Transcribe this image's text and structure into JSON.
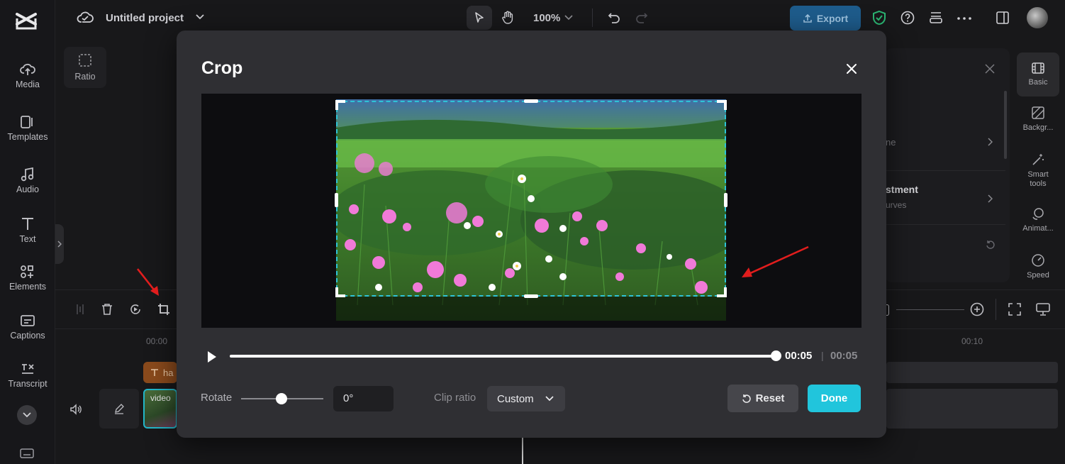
{
  "sidebar": {
    "items": [
      {
        "label": "Media"
      },
      {
        "label": "Templates"
      },
      {
        "label": "Audio"
      },
      {
        "label": "Text"
      },
      {
        "label": "Elements"
      },
      {
        "label": "Captions"
      },
      {
        "label": "Transcript"
      }
    ]
  },
  "topbar": {
    "project_title": "Untitled project",
    "zoom": "100%",
    "export_label": "Export"
  },
  "workspace": {
    "ratio_label": "Ratio"
  },
  "right_panel": {
    "row1_fragment": "ne",
    "row2_title_fragment": "stment",
    "row2_sub_fragment": "urves"
  },
  "right_tabs": [
    {
      "label": "Basic"
    },
    {
      "label": "Backgr..."
    },
    {
      "label": "Smart tools"
    },
    {
      "label": "Animat..."
    },
    {
      "label": "Speed"
    }
  ],
  "timeline": {
    "ruler_start": "00:00",
    "ruler_end": "00:10",
    "text_clip_label": "ha",
    "video_clip_label": "video"
  },
  "crop_dialog": {
    "title": "Crop",
    "time_current": "00:05",
    "time_separator": "|",
    "time_total": "00:05",
    "progress_fraction": 1.0,
    "rotate_label": "Rotate",
    "rotate_value": "0°",
    "clip_ratio_label": "Clip ratio",
    "clip_ratio_value": "Custom",
    "reset_label": "Reset",
    "done_label": "Done"
  },
  "colors": {
    "accent": "#21c5dc",
    "export_bg": "#1e5c8c",
    "annotation_arrow": "#e11d1d"
  }
}
